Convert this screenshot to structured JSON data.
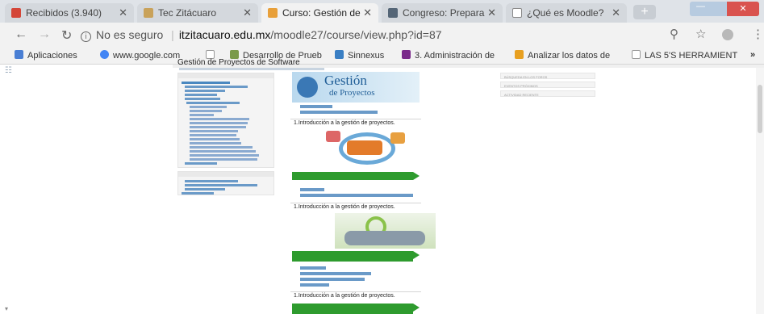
{
  "tabs": [
    {
      "title": "Recibidos (3.940)",
      "icon_color": "#d44638",
      "active": false
    },
    {
      "title": "Tec Zitácuaro",
      "icon_color": "#c9a25a",
      "active": false
    },
    {
      "title": "Curso: Gestión de",
      "icon_color": "#e8a03a",
      "active": true
    },
    {
      "title": "Congreso: Prepara",
      "icon_color": "#556677",
      "active": false
    },
    {
      "title": "¿Qué es Moodle?",
      "icon_color": "#888888",
      "active": false
    }
  ],
  "address": {
    "security": "No es seguro",
    "host": "itzitacuaro.edu.mx",
    "path": "/moodle27/course/view.php?id=87"
  },
  "bookmarks": [
    {
      "label": "Aplicaciones",
      "icon": "apps-grid-icon",
      "color": "#4a7fd4"
    },
    {
      "label": "www.google.com",
      "icon": "google-icon",
      "color": "#4285f4"
    },
    {
      "label": "",
      "icon": "page-icon",
      "color": "#999999"
    },
    {
      "label": "Desarrollo de Prueb",
      "icon": "bookmark-icon",
      "color": "#7a9a4a"
    },
    {
      "label": "Sinnexus",
      "icon": "bookmark-icon",
      "color": "#3a7fc4"
    },
    {
      "label": "3. Administración de",
      "icon": "bookmark-icon",
      "color": "#7a2a8a"
    },
    {
      "label": "Analizar los datos de",
      "icon": "bookmark-icon",
      "color": "#e8a020"
    },
    {
      "label": "LAS 5'S HERRAMIENT",
      "icon": "page-icon",
      "color": "#999999"
    }
  ],
  "more_bookmarks": "»",
  "page": {
    "title": "Gestión de Proyectos de Software",
    "logo_title": "Gestión",
    "logo_subtitle": "de Proyectos",
    "section_title": "1.Introducción a la gestión de proyectos.",
    "right_blocks": [
      "BÚSQUEDA EN LOS FOROS",
      "EVENTOS PRÓXIMOS",
      "ACTIVIDAD RECIENTE"
    ]
  },
  "colors": {
    "accent_green": "#2e9b2e",
    "link": "#3377aa",
    "tab_strip": "#dfe3e8"
  }
}
